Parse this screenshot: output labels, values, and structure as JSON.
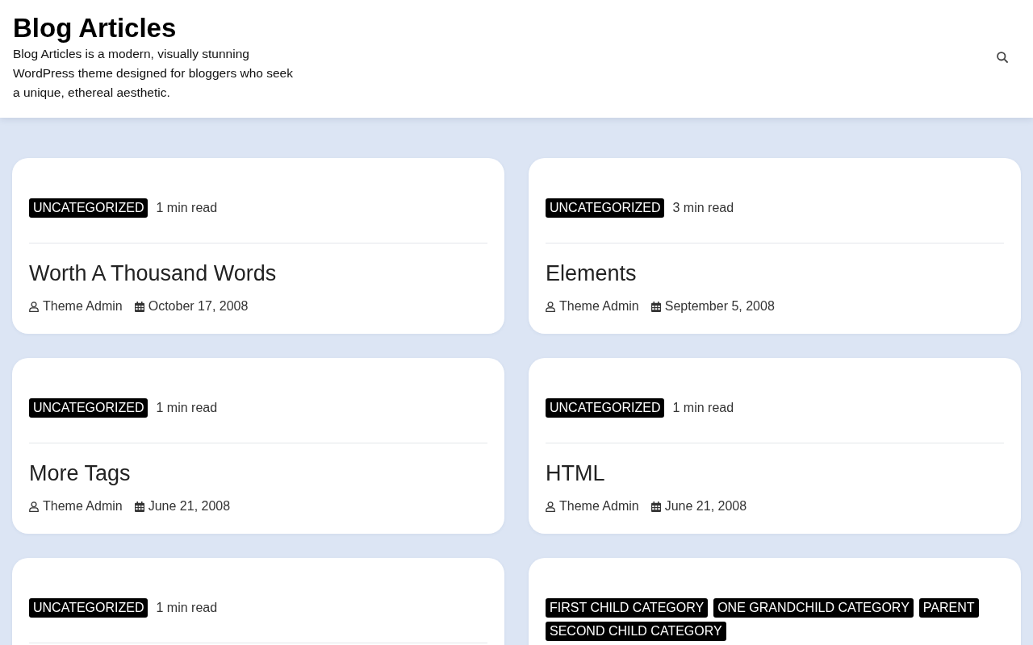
{
  "header": {
    "site_title": "Blog Articles",
    "description": "Blog Articles is a modern, visually stunning WordPress theme designed for bloggers who seek a unique, ethereal aesthetic."
  },
  "posts": [
    {
      "categories": [
        "UNCATEGORIZED"
      ],
      "read_time": "1 min read",
      "title": "Worth A Thousand Words",
      "author": "Theme Admin",
      "date": "October 17, 2008"
    },
    {
      "categories": [
        "UNCATEGORIZED"
      ],
      "read_time": "3 min read",
      "title": "Elements",
      "author": "Theme Admin",
      "date": "September 5, 2008"
    },
    {
      "categories": [
        "UNCATEGORIZED"
      ],
      "read_time": "1 min read",
      "title": "More Tags",
      "author": "Theme Admin",
      "date": "June 21, 2008"
    },
    {
      "categories": [
        "UNCATEGORIZED"
      ],
      "read_time": "1 min read",
      "title": "HTML",
      "author": "Theme Admin",
      "date": "June 21, 2008"
    },
    {
      "categories": [
        "UNCATEGORIZED"
      ],
      "read_time": "1 min read"
    },
    {
      "categories": [
        "FIRST CHILD CATEGORY",
        "ONE GRANDCHILD CATEGORY",
        "PARENT",
        "SECOND CHILD CATEGORY"
      ]
    }
  ]
}
